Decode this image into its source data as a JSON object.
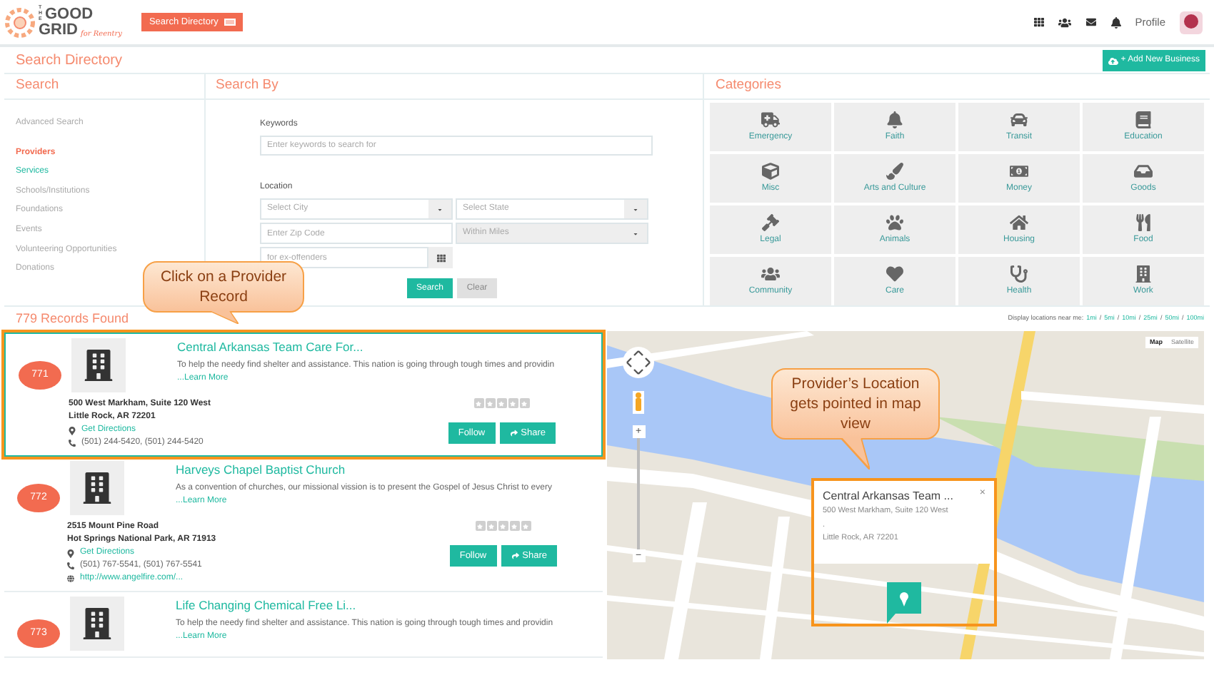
{
  "header": {
    "logo": {
      "line_1": "THE",
      "line_2": "GOOD",
      "line_3": "GRID",
      "tagline": "for Reentry"
    },
    "directory_button": "Search Directory",
    "profile": "Profile"
  },
  "page_title": "Search Directory",
  "add_button": "+ Add New Business",
  "search_panel": {
    "title": "Search",
    "items": [
      {
        "label": "Advanced Search",
        "selected": false,
        "highlighted": false
      },
      {
        "label": "Providers",
        "selected": true,
        "highlighted": false
      },
      {
        "label": "Services",
        "selected": false,
        "highlighted": true
      },
      {
        "label": "Schools/Institutions",
        "selected": false,
        "highlighted": false
      },
      {
        "label": "Foundations",
        "selected": false,
        "highlighted": false
      },
      {
        "label": "Events",
        "selected": false,
        "highlighted": false
      },
      {
        "label": "Volunteering Opportunities",
        "selected": false,
        "highlighted": false
      },
      {
        "label": "Donations",
        "selected": false,
        "highlighted": false
      }
    ]
  },
  "search_by": {
    "title": "Search By",
    "keywords_label": "Keywords",
    "keywords": {
      "placeholder": "Enter keywords to search for"
    },
    "location_label": "Location",
    "city": {
      "placeholder": "Select City"
    },
    "state": {
      "placeholder": "Select State"
    },
    "zip": {
      "placeholder": "Enter Zip Code"
    },
    "miles": {
      "placeholder": "Within Miles",
      "disabled": true
    },
    "category": {
      "placeholder": "for ex-offenders"
    },
    "search_button": "Search",
    "clear_button": "Clear"
  },
  "categories": {
    "title": "Categories",
    "items": [
      "Emergency",
      "Faith",
      "Transit",
      "Education",
      "Misc",
      "Arts and Culture",
      "Money",
      "Goods",
      "Legal",
      "Animals",
      "Housing",
      "Food",
      "Community",
      "Care",
      "Health",
      "Work"
    ]
  },
  "results": {
    "count": "779 Records Found",
    "records": [
      {
        "number": "771",
        "title": "Central Arkansas Team Care For...",
        "description": "To help the needy find shelter and assistance. This nation is going through tough times and providin",
        "learn_more": "...Learn More",
        "address": [
          "500 West Markham, Suite 120 West",
          "Little Rock, AR 72201"
        ],
        "directions": "Get Directions",
        "phone": "(501) 244-5420, (501) 244-5420",
        "stars": 0,
        "follow": "Follow",
        "share": "Share",
        "selected": true
      },
      {
        "number": "772",
        "title": "Harveys Chapel Baptist Church",
        "description": "As a convention of churches, our missional vission is to present the Gospel of Jesus Christ to every",
        "learn_more": "...Learn More",
        "address": [
          "2515 Mount Pine Road",
          "Hot Springs National Park, AR 71913"
        ],
        "directions": "Get Directions",
        "phone": "(501) 767-5541, (501) 767-5541",
        "website": "http://www.angelfire.com/...",
        "stars": 0,
        "follow": "Follow",
        "share": "Share",
        "selected": false
      },
      {
        "number": "773",
        "title": "Life Changing Chemical Free Li...",
        "description": "To help the needy find shelter and assistance. This nation is going through tough times and providin",
        "learn_more": "...Learn More",
        "selected": false
      }
    ]
  },
  "distance": {
    "label": "Display locations near me:",
    "separator": "/",
    "options": [
      "1mi",
      "5mi",
      "10mi",
      "25mi",
      "50mi",
      "100mi"
    ]
  },
  "map": {
    "zoom_in": "+",
    "zoom_out": "−",
    "types": [
      {
        "label": "Map",
        "selected": true
      },
      {
        "label": "Satellite",
        "selected": false
      }
    ],
    "info_window": {
      "title": "Central Arkansas Team ...",
      "lines": [
        "500 West Markham, Suite 120 West",
        ".",
        "Little Rock, AR 72201"
      ],
      "close": "×"
    }
  },
  "callouts": [
    {
      "text": "Click on a Provider Record"
    },
    {
      "text": "Provider’s Location gets pointed in map view"
    }
  ]
}
